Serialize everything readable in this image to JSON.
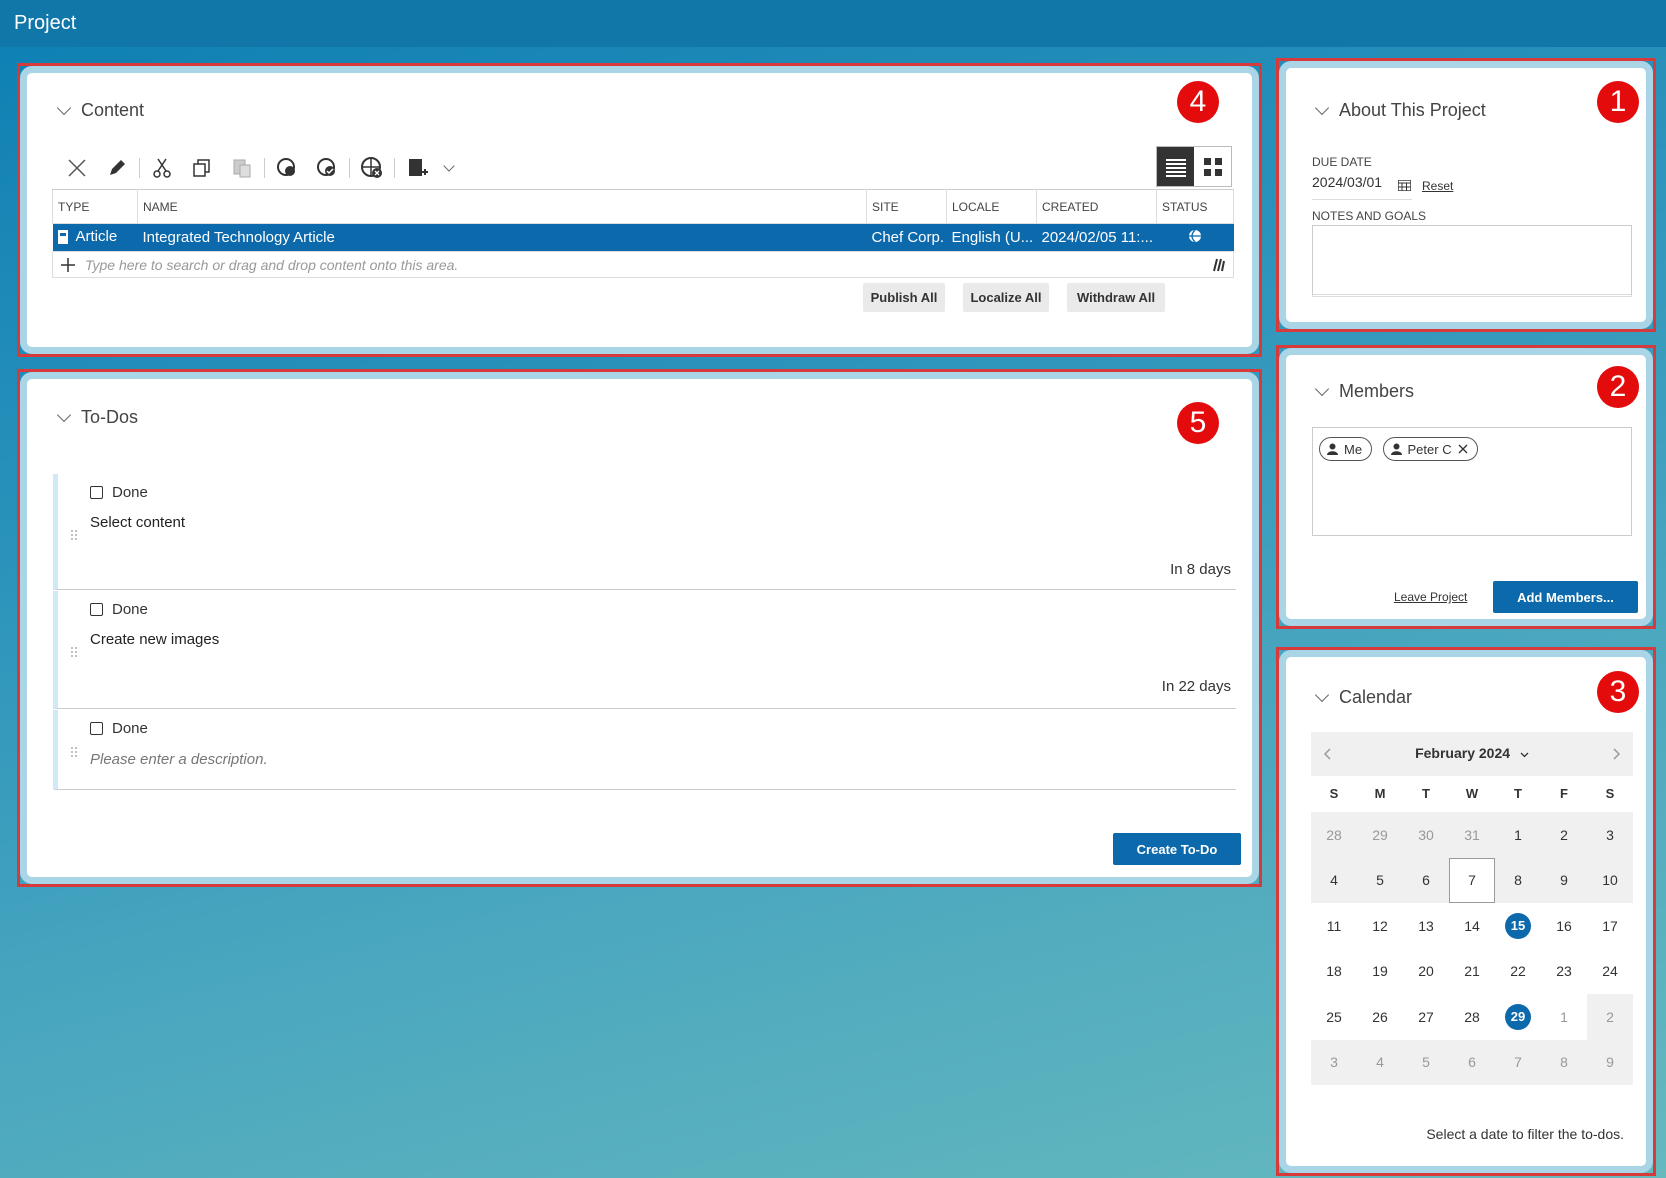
{
  "app": {
    "title": "Project"
  },
  "badges": {
    "about": "1",
    "members": "2",
    "calendar": "3",
    "content": "4",
    "todos": "5"
  },
  "content": {
    "title": "Content",
    "columns": [
      "TYPE",
      "NAME",
      "SITE",
      "LOCALE",
      "CREATED",
      "STATUS"
    ],
    "rows": [
      {
        "type": "Article",
        "name": "Integrated Technology Article",
        "site": "Chef Corp.",
        "locale": "English (U...",
        "created": "2024/02/05 11:...",
        "status_icon": "globe-status-icon"
      }
    ],
    "search_placeholder": "Type here to search or drag and drop content onto this area.",
    "buttons": {
      "publish_all": "Publish All",
      "localize_all": "Localize All",
      "withdraw_all": "Withdraw All"
    }
  },
  "todos": {
    "title": "To-Dos",
    "items": [
      {
        "done_label": "Done",
        "description": "Select content",
        "due": "In 8 days"
      },
      {
        "done_label": "Done",
        "description": "Create new images",
        "due": "In 22 days"
      },
      {
        "done_label": "Done",
        "description": "Please enter a description.",
        "due": ""
      }
    ],
    "create_button": "Create To-Do"
  },
  "about": {
    "title": "About This Project",
    "due_date_label": "DUE DATE",
    "due_date_value": "2024/03/01",
    "reset_label": "Reset",
    "notes_label": "NOTES AND GOALS"
  },
  "members": {
    "title": "Members",
    "chips": [
      "Me",
      "Peter C"
    ],
    "leave_label": "Leave Project",
    "add_label": "Add Members..."
  },
  "calendar": {
    "title": "Calendar",
    "month_label": "February 2024",
    "weekdays": [
      "S",
      "M",
      "T",
      "W",
      "T",
      "F",
      "S"
    ],
    "hint": "Select a date to filter the to-dos.",
    "accent": "#0b69ac"
  }
}
